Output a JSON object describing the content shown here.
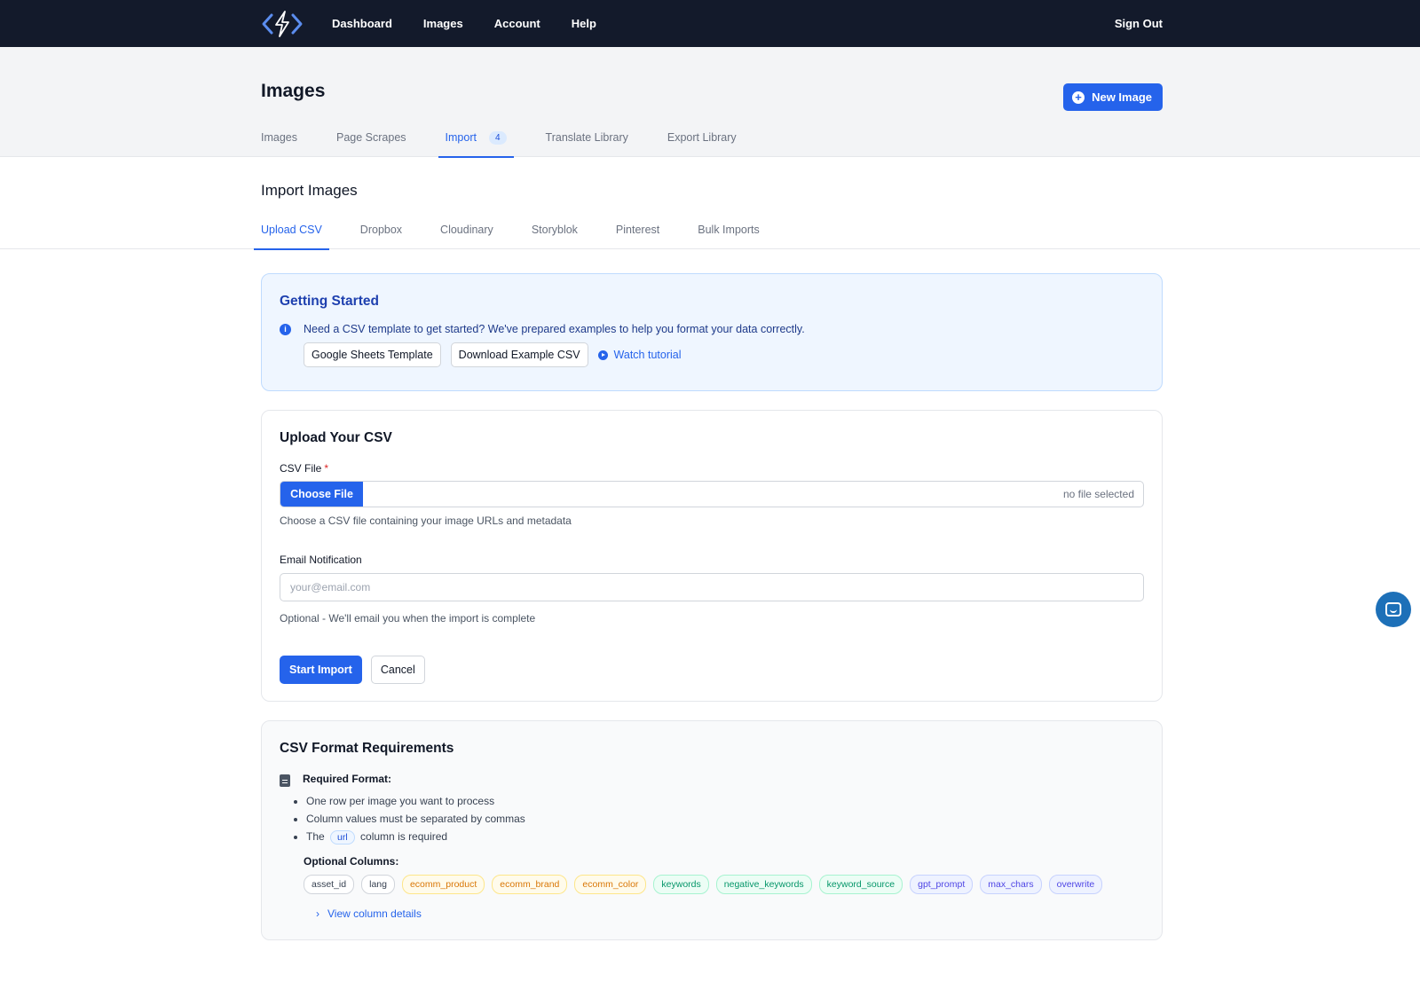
{
  "nav": {
    "items": [
      "Dashboard",
      "Images",
      "Account",
      "Help"
    ],
    "sign_out": "Sign Out"
  },
  "header": {
    "title": "Images",
    "new_image_label": "New Image",
    "tabs": [
      {
        "label": "Images"
      },
      {
        "label": "Page Scrapes"
      },
      {
        "label": "Import",
        "count": "4"
      },
      {
        "label": "Translate Library"
      },
      {
        "label": "Export Library"
      }
    ],
    "active_tab": "Import"
  },
  "import": {
    "title": "Import Images",
    "subtabs": [
      "Upload CSV",
      "Dropbox",
      "Cloudinary",
      "Storyblok",
      "Pinterest",
      "Bulk Imports"
    ],
    "active_subtab": "Upload CSV"
  },
  "getting_started": {
    "title": "Getting Started",
    "text": "Need a CSV template to get started? We've prepared examples to help you format your data correctly.",
    "sheets_button": "Google Sheets Template",
    "download_button": "Download Example CSV",
    "watch_link": "Watch tutorial"
  },
  "upload": {
    "title": "Upload Your CSV",
    "file_label": "CSV File",
    "required_mark": "*",
    "choose_file": "Choose File",
    "no_file": "no file selected",
    "file_help": "Choose a CSV file containing your image URLs and metadata",
    "email_label": "Email Notification",
    "email_placeholder": "your@email.com",
    "email_value": "",
    "email_help": "Optional - We'll email you when the import is complete",
    "start_button": "Start Import",
    "cancel_button": "Cancel"
  },
  "format": {
    "title": "CSV Format Requirements",
    "required_title": "Required Format:",
    "bullet_1": "One row per image you want to process",
    "bullet_2": "Column values must be separated by commas",
    "bullet_3_pre": "The",
    "bullet_3_code": "url",
    "bullet_3_post": "column is required",
    "optional_title": "Optional Columns:",
    "columns": [
      {
        "name": "asset_id",
        "color": "#374151"
      },
      {
        "name": "lang",
        "color": "#374151"
      },
      {
        "name": "ecomm_product",
        "color": "#d97706"
      },
      {
        "name": "ecomm_brand",
        "color": "#d97706"
      },
      {
        "name": "ecomm_color",
        "color": "#d97706"
      },
      {
        "name": "keywords",
        "color": "#059669"
      },
      {
        "name": "negative_keywords",
        "color": "#059669"
      },
      {
        "name": "keyword_source",
        "color": "#059669"
      },
      {
        "name": "gpt_prompt",
        "color": "#4f46e5"
      },
      {
        "name": "max_chars",
        "color": "#4f46e5"
      },
      {
        "name": "overwrite",
        "color": "#4f46e5"
      }
    ],
    "details_link": "View column details"
  },
  "colors": {
    "navbar": "#131a2b",
    "accent": "#2563eb",
    "chat": "#1d70b8"
  }
}
